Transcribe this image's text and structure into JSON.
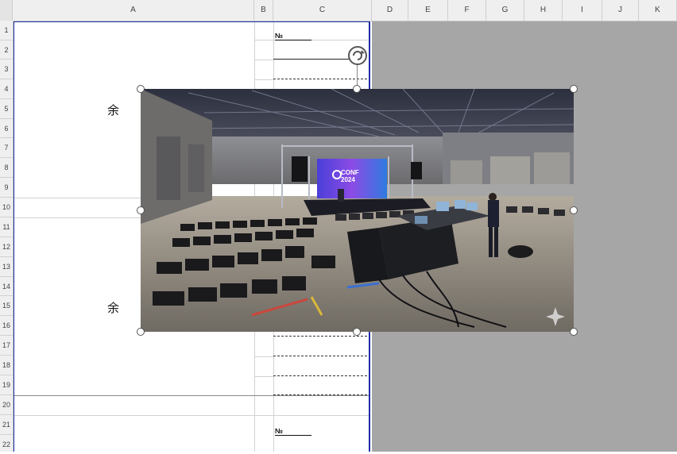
{
  "columns": [
    "A",
    "B",
    "C",
    "D",
    "E",
    "F",
    "G",
    "H",
    "I",
    "J",
    "K"
  ],
  "rows": [
    "1",
    "2",
    "3",
    "4",
    "5",
    "6",
    "7",
    "8",
    "9",
    "10",
    "11",
    "12",
    "13",
    "14",
    "15",
    "16",
    "17",
    "18",
    "19",
    "20",
    "21",
    "22"
  ],
  "cells": {
    "c1_label": "№",
    "c21_label": "№",
    "a_upper_char": "余",
    "a_lower_char": "余"
  },
  "image": {
    "banner_line1": "CONF",
    "banner_line2": "2024"
  },
  "colors": {
    "print_border": "#1f2ea8",
    "outside_area": "#a6a6a6",
    "header_bg": "#efefef"
  }
}
